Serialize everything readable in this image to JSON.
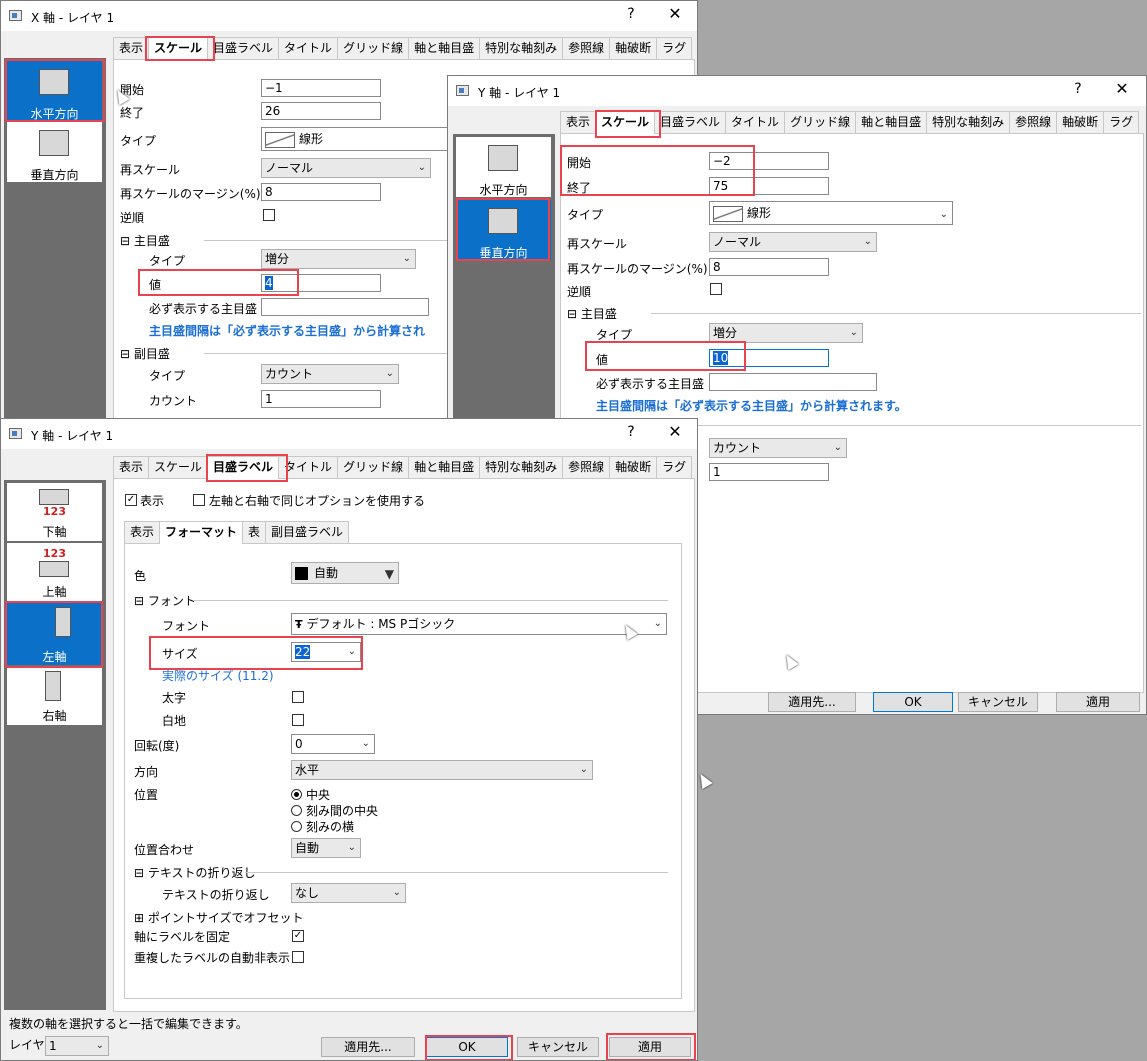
{
  "win_x": {
    "title": "X 軸 - レイヤ 1",
    "help": "?",
    "close": "✕",
    "tabs": [
      "表示",
      "スケール",
      "目盛ラベル",
      "タイトル",
      "グリッド線",
      "軸と軸目盛",
      "特別な軸刻み",
      "参照線",
      "軸破断",
      "ラグ"
    ],
    "axes": [
      "水平方向",
      "垂直方向"
    ],
    "scale": {
      "start_label": "開始",
      "start_value": "−1",
      "end_label": "終了",
      "end_value": "26",
      "type_label": "タイプ",
      "type_value": "線形",
      "rescale_label": "再スケール",
      "rescale_value": "ノーマル",
      "margin_label": "再スケールのマージン(%)",
      "margin_value": "8",
      "reverse_label": "逆順",
      "major_label": "主目盛",
      "major_type_label": "タイプ",
      "major_type_value": "増分",
      "major_value_label": "値",
      "major_value": "4",
      "required_label": "必ず表示する主目盛",
      "note": "主目盛間隔は「必ず表示する主目盛」から計算され",
      "minor_label": "副目盛",
      "minor_type_label": "タイプ",
      "minor_type_value": "カウント",
      "count_label": "カウント",
      "count_value": "1"
    }
  },
  "win_y_scale": {
    "title": "Y 軸 - レイヤ 1",
    "help": "?",
    "close": "✕",
    "tabs": [
      "表示",
      "スケール",
      "目盛ラベル",
      "タイトル",
      "グリッド線",
      "軸と軸目盛",
      "特別な軸刻み",
      "参照線",
      "軸破断",
      "ラグ"
    ],
    "axes": [
      "水平方向",
      "垂直方向"
    ],
    "scale": {
      "start_label": "開始",
      "start_value": "−2",
      "end_label": "終了",
      "end_value": "75",
      "type_label": "タイプ",
      "type_value": "線形",
      "rescale_label": "再スケール",
      "rescale_value": "ノーマル",
      "margin_label": "再スケールのマージン(%)",
      "margin_value": "8",
      "reverse_label": "逆順",
      "major_label": "主目盛",
      "major_type_label": "タイプ",
      "major_type_value": "増分",
      "major_value_label": "値",
      "major_value": "10",
      "required_label": "必ず表示する主目盛",
      "note": "主目盛間隔は「必ず表示する主目盛」から計算されます。",
      "minor_type_value": "カウント",
      "count_value": "1"
    },
    "buttons": {
      "apply_to": "適用先...",
      "ok": "OK",
      "cancel": "キャンセル",
      "apply": "適用"
    }
  },
  "win_y_labels": {
    "title": "Y 軸 - レイヤ 1",
    "help": "?",
    "close": "✕",
    "tabs": [
      "表示",
      "スケール",
      "目盛ラベル",
      "タイトル",
      "グリッド線",
      "軸と軸目盛",
      "特別な軸刻み",
      "参照線",
      "軸破断",
      "ラグ"
    ],
    "axes": [
      "下軸",
      "上軸",
      "左軸",
      "右軸"
    ],
    "axis_digits": "123",
    "show_label": "表示",
    "same_option_label": "左軸と右軸で同じオプションを使用する",
    "subtabs": [
      "表示",
      "フォーマット",
      "表",
      "副目盛ラベル"
    ],
    "format": {
      "color_label": "色",
      "color_value": "自動",
      "font_section": "フォント",
      "font_label": "フォント",
      "font_value": "デフォルト : MS Pゴシック",
      "size_label": "サイズ",
      "size_value": "22",
      "actual_size": "実際のサイズ (11.2)",
      "bold_label": "太字",
      "white_label": "白地",
      "rotation_label": "回転(度)",
      "rotation_value": "0",
      "direction_label": "方向",
      "direction_value": "水平",
      "position_label": "位置",
      "position_options": [
        "中央",
        "刻み間の中央",
        "刻みの横"
      ],
      "align_label": "位置合わせ",
      "align_value": "自動",
      "wrap_section": "テキストの折り返し",
      "wrap_label": "テキストの折り返し",
      "wrap_value": "なし",
      "offset_section": "ポイントサイズでオフセット",
      "fix_label": "軸にラベルを固定",
      "autohide_label": "重複したラベルの自動非表示"
    },
    "status": "複数の軸を選択すると一括で編集できます。",
    "layer_label": "レイヤ",
    "layer_value": "1",
    "buttons": {
      "apply_to": "適用先...",
      "ok": "OK",
      "cancel": "キャンセル",
      "apply": "適用"
    }
  },
  "icons": {
    "check": "✓",
    "dropdown": "⌄",
    "collapse": "⊟",
    "expand": "⊞"
  },
  "colors": {
    "selection": "#0b70c8",
    "highlight": "#e8434f",
    "note": "#1a6fd6"
  }
}
